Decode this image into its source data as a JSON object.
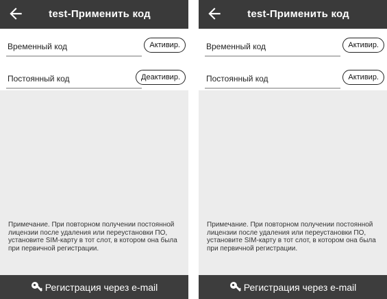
{
  "screens": [
    {
      "title": "test-Применить код",
      "temp_field_label": "Временный код",
      "temp_button": "Активир.",
      "perm_field_label": "Постоянный код",
      "perm_button": "Деактивир.",
      "note": "Примечание. При повторном получении постоянной лицензии после удаления или переустановки ПО, установите SIM-карту в тот слот, в котором она была при первичной регистрации.",
      "bottom_button": "Регистрация через e-mail"
    },
    {
      "title": "test-Применить код",
      "temp_field_label": "Временный код",
      "temp_button": "Активир.",
      "perm_field_label": "Постоянный код",
      "perm_button": "Активир.",
      "note": "Примечание. При повторном получении постоянной лицензии после удаления или переустановки ПО, установите SIM-карту в тот слот, в котором она была при первичной регистрации.",
      "bottom_button": "Регистрация через e-mail"
    }
  ],
  "icons": {
    "back": "arrow-left-icon",
    "bottom": "key-icon"
  },
  "colors": {
    "appbar": "#3a3a3a",
    "bottombar": "#3d3d3d",
    "background": "#ececec"
  }
}
